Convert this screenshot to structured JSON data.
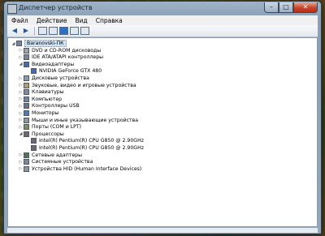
{
  "window": {
    "title": "Диспетчер устройств",
    "close_glyph": "✕",
    "maximize_glyph": "□",
    "minimize_glyph": "–"
  },
  "menu": [
    {
      "label": "Файл"
    },
    {
      "label": "Действие"
    },
    {
      "label": "Вид"
    },
    {
      "label": "Справка"
    }
  ],
  "toolbar": {
    "back_glyph": "◀",
    "forward_glyph": "▶"
  },
  "tree": [
    {
      "label": "Baranovski-ПК",
      "expanded": true,
      "level": 0,
      "icon": "computer-icon",
      "color": "#6f87a3",
      "selected": true
    },
    {
      "label": "DVD и CD-ROM дисководы",
      "expanded": false,
      "level": 1,
      "icon": "dvd-drive-icon",
      "color": "#9aa4ad"
    },
    {
      "label": "IDE ATA/ATAPI контроллеры",
      "expanded": false,
      "level": 1,
      "icon": "ide-controller-icon",
      "color": "#7a8896"
    },
    {
      "label": "Видеоадаптеры",
      "expanded": true,
      "level": 1,
      "icon": "display-adapter-icon",
      "color": "#3d6fb0"
    },
    {
      "label": "NVIDIA GeForce GTX 480",
      "expanded": null,
      "level": 2,
      "icon": "display-adapter-icon",
      "color": "#3d6fb0"
    },
    {
      "label": "Дисковые устройства",
      "expanded": false,
      "level": 1,
      "icon": "disk-drive-icon",
      "color": "#8e9aa6"
    },
    {
      "label": "Звуковые, видео и игровые устройства",
      "expanded": false,
      "level": 1,
      "icon": "sound-icon",
      "color": "#b0a070"
    },
    {
      "label": "Клавиатуры",
      "expanded": false,
      "level": 1,
      "icon": "keyboard-icon",
      "color": "#7d8a97"
    },
    {
      "label": "Компьютер",
      "expanded": false,
      "level": 1,
      "icon": "computer-icon",
      "color": "#6f87a3"
    },
    {
      "label": "Контроллеры USB",
      "expanded": false,
      "level": 1,
      "icon": "usb-icon",
      "color": "#6a7884"
    },
    {
      "label": "Мониторы",
      "expanded": false,
      "level": 1,
      "icon": "monitor-icon",
      "color": "#4a7ab8"
    },
    {
      "label": "Мыши и иные указывающие устройства",
      "expanded": false,
      "level": 1,
      "icon": "mouse-icon",
      "color": "#8a96a2"
    },
    {
      "label": "Порты (COM и LPT)",
      "expanded": false,
      "level": 1,
      "icon": "port-icon",
      "color": "#7d8a6a"
    },
    {
      "label": "Процессоры",
      "expanded": true,
      "level": 1,
      "icon": "processor-icon",
      "color": "#6a6a6a"
    },
    {
      "label": "Intel(R) Pentium(R) CPU G850 @ 2.90GHz",
      "expanded": null,
      "level": 2,
      "icon": "processor-icon",
      "color": "#6a6a6a"
    },
    {
      "label": "Intel(R) Pentium(R) CPU G850 @ 2.90GHz",
      "expanded": null,
      "level": 2,
      "icon": "processor-icon",
      "color": "#6a6a6a"
    },
    {
      "label": "Сетевые адаптеры",
      "expanded": false,
      "level": 1,
      "icon": "network-adapter-icon",
      "color": "#4d7a4d"
    },
    {
      "label": "Системные устройства",
      "expanded": false,
      "level": 1,
      "icon": "system-device-icon",
      "color": "#7a8896"
    },
    {
      "label": "Устройства HID (Human Interface Devices)",
      "expanded": false,
      "level": 1,
      "icon": "hid-icon",
      "color": "#8a96a2"
    }
  ]
}
